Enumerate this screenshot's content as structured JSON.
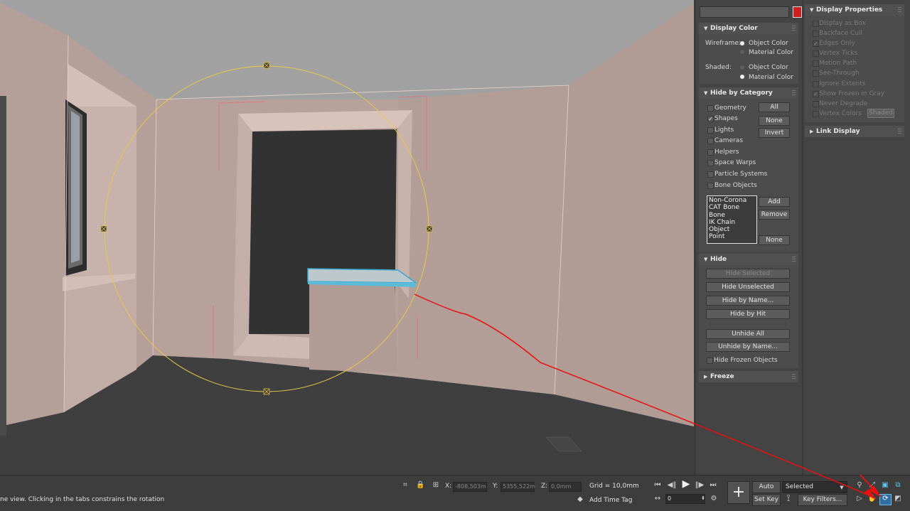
{
  "top_input": {
    "value": ""
  },
  "colors": {
    "object_swatch": "#cc2020",
    "annotation": "#e81010",
    "selection": "#e8c84a",
    "wall": "#b49c96",
    "floor": "#3e3e3e",
    "ceiling": "#a0a0a0"
  },
  "display_color": {
    "title": "Display Color",
    "wireframe_label": "Wireframe:",
    "shaded_label": "Shaded:",
    "wireframe_options": [
      "Object Color",
      "Material Color"
    ],
    "shaded_options": [
      "Object Color",
      "Material Color"
    ],
    "wireframe_selected": "Object Color",
    "shaded_selected": "Material Color"
  },
  "hide_by_category": {
    "title": "Hide by Category",
    "categories": [
      "Geometry",
      "Shapes",
      "Lights",
      "Cameras",
      "Helpers",
      "Space Warps",
      "Particle Systems",
      "Bone Objects"
    ],
    "checked": [
      "Shapes"
    ],
    "buttons": {
      "all": "All",
      "none": "None",
      "invert": "Invert"
    },
    "list_items": [
      "Non-Corona",
      "CAT Bone",
      "Bone",
      "IK Chain Object",
      "Point"
    ],
    "list_buttons": {
      "add": "Add",
      "remove": "Remove",
      "none": "None"
    }
  },
  "hide": {
    "title": "Hide",
    "buttons": [
      "Hide Selected",
      "Hide Unselected",
      "Hide by Name...",
      "Hide by Hit",
      "Unhide All",
      "Unhide by Name..."
    ],
    "hide_frozen_label": "Hide Frozen Objects"
  },
  "freeze": {
    "title": "Freeze"
  },
  "display_properties": {
    "title": "Display Properties",
    "items": [
      "Display as Box",
      "Backface Cull",
      "Edges Only",
      "Vertex Ticks",
      "Motion Path",
      "See-Through",
      "Ignore Extents",
      "Show Frozen in Gray",
      "Never Degrade",
      "Vertex Colors"
    ],
    "checked": [
      "Edges Only",
      "Show Frozen in Gray"
    ],
    "shaded_button": "Shaded"
  },
  "link_display": {
    "title": "Link Display"
  },
  "status": {
    "prompt": "ne view.  Clicking in the tabs constrains the rotation",
    "x_label": "X:",
    "x_value": "-808,503m",
    "y_label": "Y:",
    "y_value": "5355,522m",
    "z_label": "Z:",
    "z_value": "0,0mm",
    "grid": "Grid = 10,0mm",
    "add_time_tag": "Add Time Tag"
  },
  "animation": {
    "frame": "0",
    "auto_key": "Auto Key",
    "set_key": "Set Key",
    "selected": "Selected",
    "key_filters": "Key Filters..."
  }
}
